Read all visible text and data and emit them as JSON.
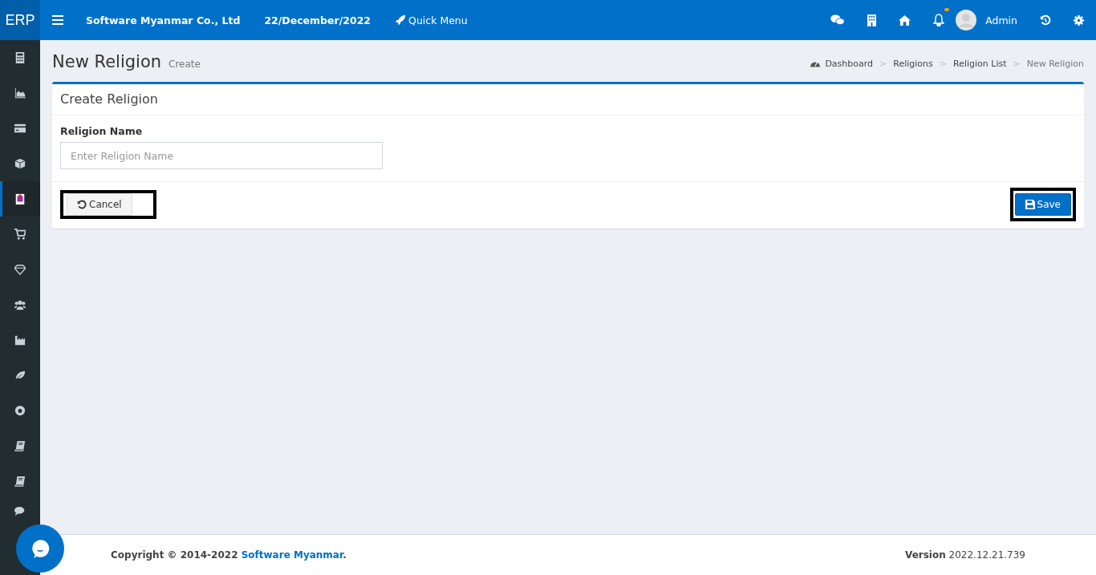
{
  "topbar": {
    "logo": "ERP",
    "company": "Software Myanmar Co., Ltd",
    "date": "22/December/2022",
    "quick_menu": "Quick Menu",
    "notification_dot": true,
    "user": "Admin"
  },
  "sidebar": {
    "items": [
      {
        "selected": false
      },
      {
        "selected": false
      },
      {
        "selected": false
      },
      {
        "selected": false
      },
      {
        "selected": true
      },
      {
        "selected": false
      },
      {
        "selected": false
      },
      {
        "selected": false
      },
      {
        "selected": false
      },
      {
        "selected": false
      },
      {
        "selected": false
      },
      {
        "selected": false
      },
      {
        "selected": false
      },
      {
        "selected": false
      }
    ]
  },
  "page": {
    "title": "New Religion",
    "subtitle": "Create",
    "breadcrumb": [
      "Dashboard",
      "Religions",
      "Religion List",
      "New Religion"
    ],
    "breadcrumb_separator": ">"
  },
  "card": {
    "title": "Create Religion",
    "field": {
      "label": "Religion Name",
      "placeholder": "Enter Religion Name"
    },
    "buttons": [
      {
        "kind": "cancel",
        "label": "Cancel",
        "highlighted": true
      },
      {
        "kind": "save",
        "label": "Save",
        "highlighted": true
      }
    ]
  },
  "footer": {
    "copyright": "Copyright © 2014-2022",
    "link": "Software Myanmar",
    "after_link": ".",
    "version": "**Version** 2022.12.21.739"
  }
}
